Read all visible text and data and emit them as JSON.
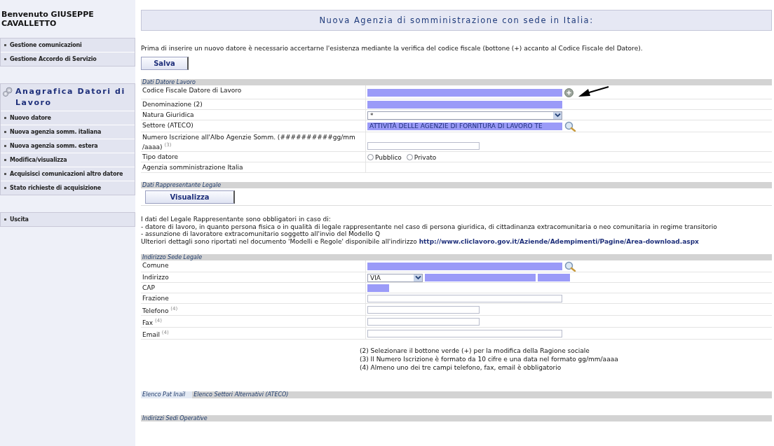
{
  "sidebar": {
    "welcome": "Benvenuto GIUSEPPE CAVALLETTO",
    "groups": [
      {
        "items": [
          "Gestione comunicazioni",
          "Gestione Accordo di Servizio"
        ]
      },
      {
        "title": "Anagrafica Datori di Lavoro",
        "items": [
          "Nuovo datore",
          "Nuova agenzia somm. italiana",
          "Nuova agenzia somm. estera",
          "Modifica/visualizza",
          "Acquisisci comunicazioni altro datore",
          "Stato richieste di acquisizione"
        ]
      },
      {
        "items": [
          "Uscita"
        ]
      }
    ]
  },
  "title": "Nuova Agenzia di somministrazione con sede in Italia:",
  "intro": "Prima di inserire un nuovo datore è necessario accertarne l'esistenza mediante la verifica del codice fiscale (bottone (+) accanto al Codice Fiscale del Datore).",
  "save_button": "Salva",
  "employer": {
    "header": "Dati Datore Lavoro",
    "rows": [
      {
        "label": "Codice Fiscale Datore di Lavoro",
        "kind": "text",
        "required": true,
        "add_button": true
      },
      {
        "label": "Denominazione (2)",
        "kind": "text",
        "required": true
      },
      {
        "label": "Natura Giuridica",
        "kind": "select",
        "value": "*"
      },
      {
        "label": "Settore (ATECO)",
        "kind": "text",
        "required": true,
        "value": "ATTIVITÀ DELLE AGENZIE DI FORNITURA DI LAVORO TE",
        "search_button": true
      },
      {
        "label": "Numero Iscrizione all'Albo Agenzie Somm. (##########gg/mm /aaaa) $^{(3)}$",
        "kind": "short-text",
        "required": false
      },
      {
        "label": "Tipo datore",
        "kind": "radio",
        "options": [
          {
            "label": "Pubblico",
            "selected": false
          },
          {
            "label": "Privato",
            "selected": false
          }
        ]
      },
      {
        "label": "Agenzia somministrazione Italia",
        "kind": "empty"
      }
    ]
  },
  "legal": {
    "header": "Dati Rappresentante Legale",
    "button": "Visualizza",
    "note_lines": [
      "I dati del Legale Rappresentante sono obbligatori in caso di:",
      "- datore di lavoro, in quanto persona fisica o in qualità di legale rappresentante nel caso di persona giuridica, di cittadinanza extracomunitaria o neo comunitaria in regime transitorio",
      "- assunzione di lavoratore extracomunitario soggetto all'invio del Modello Q"
    ],
    "note_last": "Ulteriori dettagli sono riportati nel documento 'Modelli e Regole' disponibile all'indirizzo",
    "link": "http://www.cliclavoro.gov.it/Aziende/Adempimenti/Pagine/Area-download.aspx"
  },
  "address": {
    "header": "Indirizzo Sede Legale",
    "rows": [
      {
        "label": "Comune",
        "kind": "text",
        "required": true,
        "search_button": true
      },
      {
        "label": "Indirizzo",
        "kind": "address",
        "value": "VIA"
      },
      {
        "label": "CAP",
        "kind": "tiny-text",
        "required": true
      },
      {
        "label": "Frazione",
        "kind": "text",
        "required": false
      },
      {
        "label": "Telefono $^{(4)}$",
        "kind": "short-text",
        "required": false
      },
      {
        "label": "Fax $^{(4)}$",
        "kind": "short-text",
        "required": false
      },
      {
        "label": "Email $^{(4)}$",
        "kind": "text",
        "required": false
      }
    ]
  },
  "footnotes": [
    "(2) Selezionare il bottone verde (+) per la modifica della Ragione sociale",
    "(3) Il Numero Iscrizione è formato da 10 cifre e una data nel formato gg/mm/aaaa",
    "(4) Almeno uno dei tre campi telefono, fax, email è obbligatorio"
  ],
  "tabs": [
    {
      "label": "Elenco Pat Inail",
      "selected": true
    },
    {
      "label": "Elenco Settori Alternativi (ATECO)",
      "selected": false
    }
  ],
  "operative_header": "Indirizzi Sedi Operative"
}
